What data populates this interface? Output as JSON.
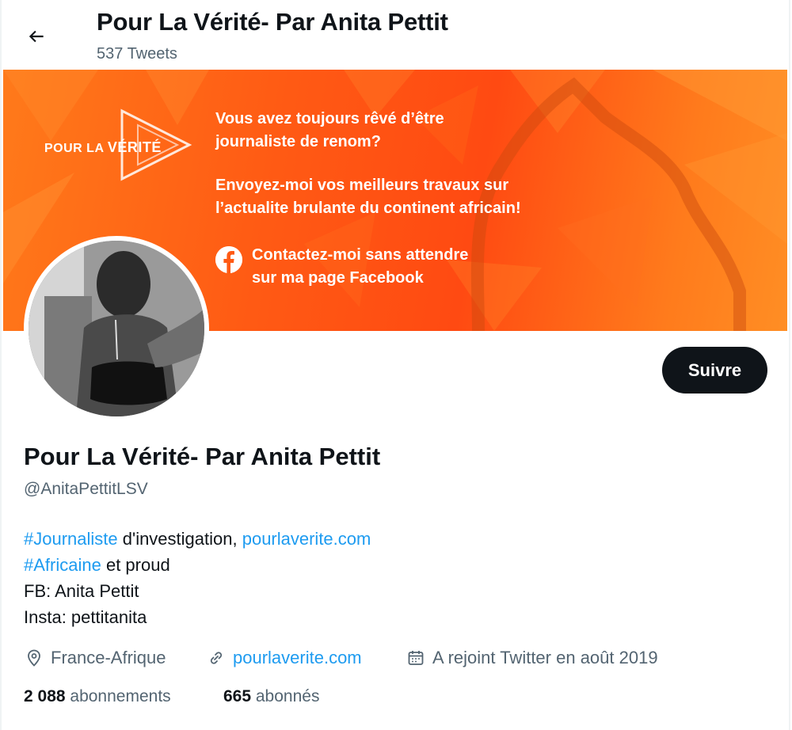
{
  "header": {
    "title": "Pour La Vérité- Par Anita Pettit",
    "tweet_count": "537 Tweets",
    "back_icon": "arrow-left-icon"
  },
  "banner": {
    "brand_prefix": "POUR LA ",
    "brand_suffix": "VÉRITÉ",
    "promo_line_1": "Vous avez toujours rêvé d’être",
    "promo_line_2": "journaliste de renom?",
    "promo_line_3": "Envoyez-moi  vos meilleurs travaux sur",
    "promo_line_4": "l’actualite brulante du continent africain!",
    "promo_line_5": "Contactez-moi sans attendre",
    "promo_line_6": "sur ma page Facebook",
    "colors": {
      "orange": "#ff5a14",
      "light_orange": "#ff8e24"
    }
  },
  "profile": {
    "follow_label": "Suivre",
    "display_name": "Pour La Vérité- Par Anita Pettit",
    "handle": "@AnitaPettitLSV",
    "bio": {
      "hashtag_1": "#Journaliste",
      "text_1": " d'investigation, ",
      "link_1": "pourlaverite.com",
      "hashtag_2": "#Africaine",
      "text_2": " et proud",
      "line_3": "FB: Anita Pettit",
      "line_4": "Insta: pettitanita"
    },
    "location": "France-Afrique",
    "website": "pourlaverite.com",
    "joined": "A rejoint Twitter en août 2019",
    "following_count": "2 088",
    "following_label": " abonnements",
    "followers_count": "665",
    "followers_label": " abonnés"
  },
  "colors": {
    "link": "#1d9bf0",
    "secondary_text": "#536471",
    "primary_text": "#0f1419"
  }
}
